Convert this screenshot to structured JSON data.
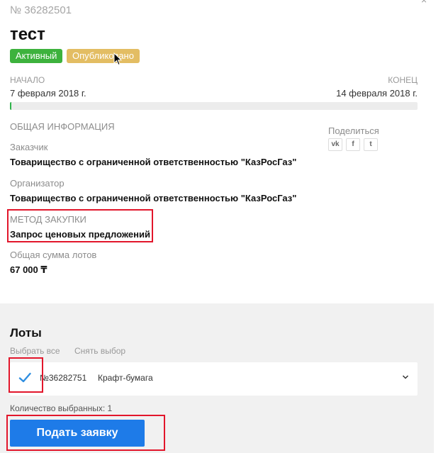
{
  "tender": {
    "number": "№ 36282501",
    "title": "тест",
    "badges": {
      "active": "Активный",
      "published": "Опубликовано"
    },
    "start_label": "НАЧАЛО",
    "start_date": "7 февраля 2018 г.",
    "end_label": "КОНЕЦ",
    "end_date": "14 февраля 2018 г.",
    "progress_fraction": 0.002,
    "colors": {
      "active": "#3db23d",
      "published": "#e3bd63",
      "progress": "#2fb34a"
    }
  },
  "info": {
    "section_title": "ОБЩАЯ ИНФОРМАЦИЯ",
    "customer_label": "Заказчик",
    "customer_value": "Товарищество с ограниченной ответственностью \"КазРосГаз\"",
    "organizer_label": "Организатор",
    "organizer_value": "Товарищество с ограниченной ответственностью \"КазРосГаз\"",
    "method_label": "МЕТОД ЗАКУПКИ",
    "method_value": "Запрос ценовых предложений",
    "total_label": "Общая сумма лотов",
    "total_value": "67 000 ₸"
  },
  "share": {
    "label": "Поделиться",
    "buttons": [
      {
        "icon": "vk-icon",
        "glyph": "vk"
      },
      {
        "icon": "facebook-icon",
        "glyph": "f"
      },
      {
        "icon": "twitter-icon",
        "glyph": "t"
      }
    ]
  },
  "lots": {
    "title": "Лоты",
    "select_all": "Выбрать все",
    "deselect": "Снять выбор",
    "items": [
      {
        "number": "№36282751",
        "name": "Крафт-бумага",
        "checked": true
      }
    ],
    "selected_count_label": "Количество выбранных: 1",
    "submit_label": "Подать заявку",
    "colors": {
      "submit": "#1e7be8",
      "check": "#2f8ee0",
      "highlight": "#e2162b"
    }
  }
}
